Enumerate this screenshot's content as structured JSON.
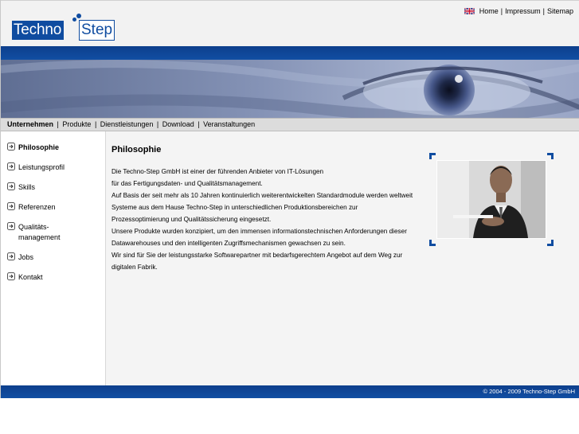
{
  "brand": {
    "logo_left": "Techno",
    "logo_right": "Step"
  },
  "toplinks": {
    "home": "Home",
    "impressum": "Impressum",
    "sitemap": "Sitemap",
    "sep": "|"
  },
  "mainnav": {
    "items": [
      "Unternehmen",
      "Produkte",
      "Dienstleistungen",
      "Download",
      "Veranstaltungen"
    ],
    "active": "Unternehmen",
    "sep": "|"
  },
  "sidebar": {
    "items": [
      {
        "label": "Philosophie",
        "active": true
      },
      {
        "label": "Leistungsprofil"
      },
      {
        "label": "Skills"
      },
      {
        "label": "Referenzen"
      },
      {
        "label_line1": "Qualitäts-",
        "label_line2": "management"
      },
      {
        "label": "Jobs"
      },
      {
        "label": "Kontakt"
      }
    ]
  },
  "content": {
    "title": "Philosophie",
    "lines": [
      "Die Techno-Step GmbH ist einer der führenden Anbieter von IT-Lösungen",
      "für das Fertigungsdaten- und Qualitätsmanagement.",
      "Auf Basis der seit mehr als 10 Jahren kontinuierlich weiterentwickelten Standardmodule werden weltweit",
      "Systeme aus dem Hause Techno-Step in unterschiedlichen Produktionsbereichen zur",
      "Prozessoptimierung und Qualitätssicherung eingesetzt.",
      "Unsere Produkte wurden konzipiert, um den immensen informationstechnischen Anforderungen dieser",
      "Datawarehouses und den intelligenten Zugriffsmechanismen gewachsen zu sein.",
      "Wir sind für Sie der leistungsstarke Softwarepartner mit bedarfsgerechtem Angebot auf dem Weg zur",
      "digitalen Fabrik."
    ]
  },
  "footer": {
    "copyright": "© 2004 - 2009 Techno-Step GmbH"
  },
  "colors": {
    "brand_blue": "#0f4ca0",
    "nav_gray": "#dcdcdc",
    "content_bg": "#f4f4f4"
  },
  "icons": {
    "language": "uk-flag-icon",
    "sidebar_bullet": "arrow-right-box-icon"
  }
}
